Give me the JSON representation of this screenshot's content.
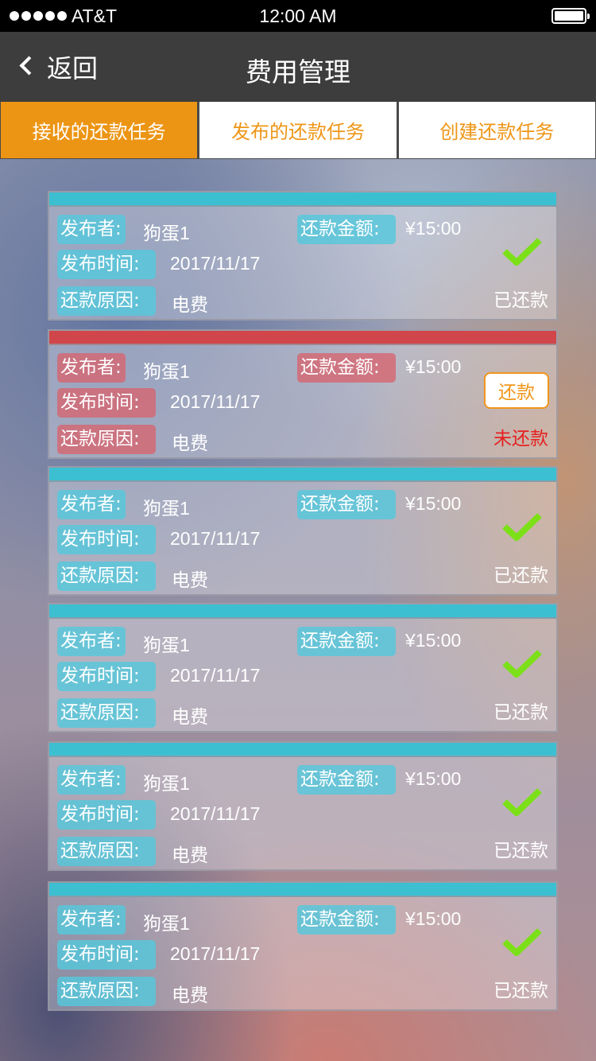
{
  "status_bar": {
    "carrier": "AT&T",
    "time": "12:00 AM",
    "signal_bars": 5
  },
  "nav": {
    "back_label": "返回",
    "title": "费用管理"
  },
  "tabs": [
    {
      "label": "接收的还款任务",
      "active": true
    },
    {
      "label": "发布的还款任务",
      "active": false
    },
    {
      "label": "创建还款任务",
      "active": false
    }
  ],
  "labels": {
    "publisher": "发布者:",
    "amount": "还款金额:",
    "time": "发布时间:",
    "reason": "还款原因:"
  },
  "colors": {
    "accent": "#ec9514",
    "paid_header": "#3dbfd2",
    "unpaid_header": "#d1464a",
    "check": "#7ce018",
    "unpaid_text": "#e52121"
  },
  "cards": [
    {
      "publisher": "狗蛋1",
      "amount": "¥15:00",
      "time": "2017/11/17",
      "reason": "电费",
      "status": "已还款",
      "paid": true
    },
    {
      "publisher": "狗蛋1",
      "amount": "¥15:00",
      "time": "2017/11/17",
      "reason": "电费",
      "status": "未还款",
      "paid": false,
      "action_label": "还款"
    },
    {
      "publisher": "狗蛋1",
      "amount": "¥15:00",
      "time": "2017/11/17",
      "reason": "电费",
      "status": "已还款",
      "paid": true
    },
    {
      "publisher": "狗蛋1",
      "amount": "¥15:00",
      "time": "2017/11/17",
      "reason": "电费",
      "status": "已还款",
      "paid": true
    },
    {
      "publisher": "狗蛋1",
      "amount": "¥15:00",
      "time": "2017/11/17",
      "reason": "电费",
      "status": "已还款",
      "paid": true
    },
    {
      "publisher": "狗蛋1",
      "amount": "¥15:00",
      "time": "2017/11/17",
      "reason": "电费",
      "status": "已还款",
      "paid": true
    }
  ]
}
